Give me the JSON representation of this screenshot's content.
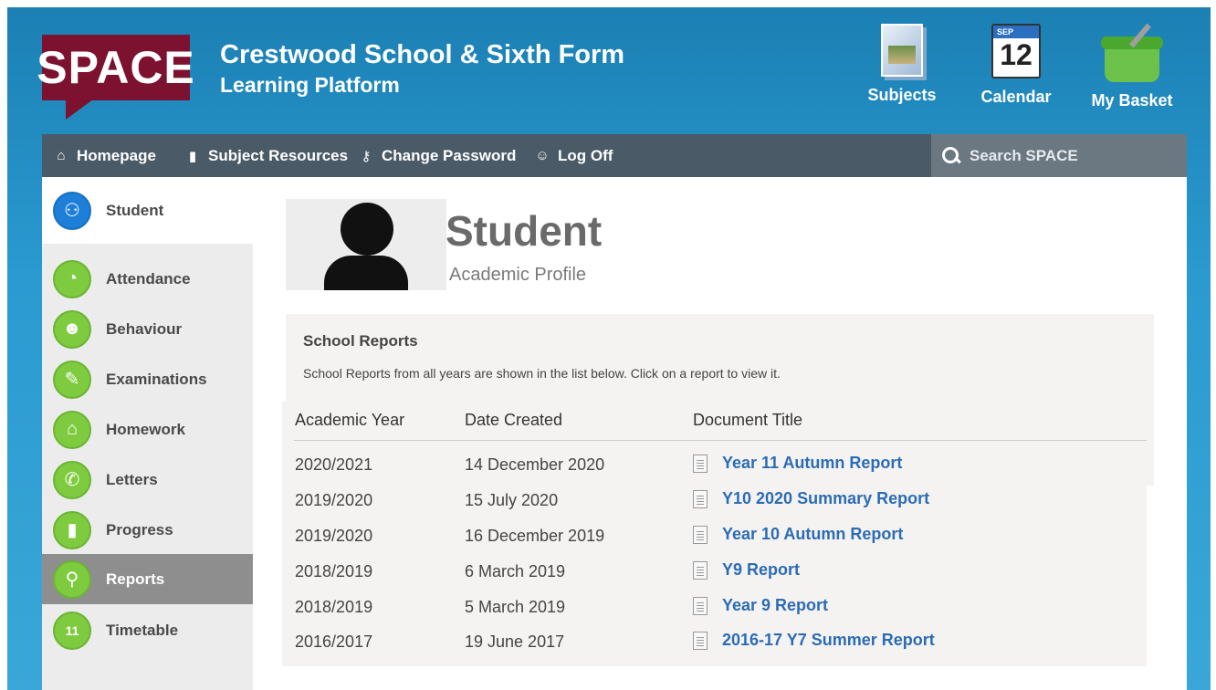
{
  "header": {
    "logo": "SPACE",
    "school_name": "Crestwood School & Sixth Form",
    "school_sub": "Learning Platform",
    "icons": [
      {
        "label": "Subjects",
        "icon": "subjects-icon"
      },
      {
        "label": "Calendar",
        "icon": "calendar-icon",
        "month": "SEP",
        "day": "12"
      },
      {
        "label": "My Basket",
        "icon": "basket-icon"
      }
    ]
  },
  "nav": {
    "items": [
      {
        "label": "Homepage",
        "icon": "home-icon"
      },
      {
        "label": "Subject Resources",
        "icon": "book-icon"
      },
      {
        "label": "Change Password",
        "icon": "key-icon"
      },
      {
        "label": "Log Off",
        "icon": "user-logoff-icon"
      }
    ],
    "search_placeholder": "Search SPACE"
  },
  "sidebar": {
    "items": [
      {
        "label": "Student",
        "icon": "student-icon"
      },
      {
        "label": "Attendance",
        "icon": "pie-chart-icon"
      },
      {
        "label": "Behaviour",
        "icon": "behaviour-icon"
      },
      {
        "label": "Examinations",
        "icon": "exam-icon"
      },
      {
        "label": "Homework",
        "icon": "home-icon"
      },
      {
        "label": "Letters",
        "icon": "phone-icon"
      },
      {
        "label": "Progress",
        "icon": "bar-chart-icon"
      },
      {
        "label": "Reports",
        "icon": "search-icon",
        "active": true
      },
      {
        "label": "Timetable",
        "icon": "calendar-icon",
        "day": "11"
      }
    ]
  },
  "profile": {
    "title": "Student",
    "subtitle": "Academic Profile"
  },
  "reports": {
    "title": "School Reports",
    "description": "School Reports from all years are shown in the list below. Click on a report to view it.",
    "columns": [
      "Academic Year",
      "Date Created",
      "Document Title"
    ],
    "rows": [
      {
        "year": "2020/2021",
        "date": "14 December 2020",
        "title": "Year 11 Autumn Report"
      },
      {
        "year": "2019/2020",
        "date": "15 July 2020",
        "title": "Y10 2020 Summary Report"
      },
      {
        "year": "2019/2020",
        "date": "16 December 2019",
        "title": "Year 10 Autumn Report"
      },
      {
        "year": "2018/2019",
        "date": "6 March 2019",
        "title": "Y9 Report"
      },
      {
        "year": "2018/2019",
        "date": "5 March 2019",
        "title": "Year 9 Report"
      },
      {
        "year": "2016/2017",
        "date": "19 June 2017",
        "title": "2016-17 Y7 Summer Report"
      }
    ]
  }
}
